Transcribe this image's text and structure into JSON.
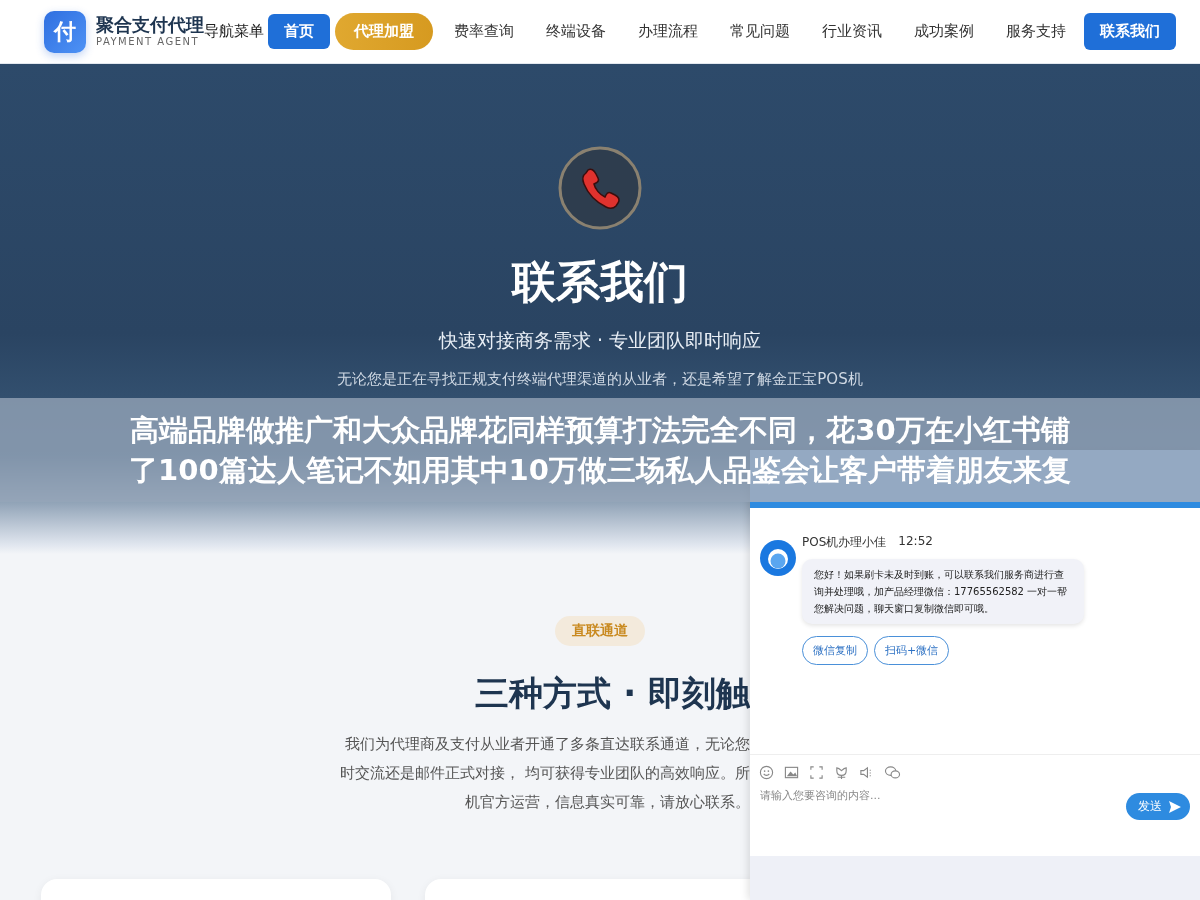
{
  "navbar": {
    "logo_mark": "付",
    "brand": "聚合支付代理",
    "brand_sub": "PAYMENT AGENT",
    "menu_label": "导航菜单",
    "items": [
      {
        "label": "首页",
        "kind": "primary"
      },
      {
        "label": "代理加盟",
        "kind": "accent"
      },
      {
        "label": "费率查询",
        "kind": "link"
      },
      {
        "label": "终端设备",
        "kind": "link"
      },
      {
        "label": "办理流程",
        "kind": "link"
      },
      {
        "label": "常见问题",
        "kind": "link"
      },
      {
        "label": "行业资讯",
        "kind": "link"
      },
      {
        "label": "成功案例",
        "kind": "link"
      },
      {
        "label": "服务支持",
        "kind": "link"
      },
      {
        "label": "联系我们",
        "kind": "primary"
      }
    ]
  },
  "hero": {
    "title": "联系我们",
    "subtitle": "快速对接商务需求 · 专业团队即时响应",
    "paragraph": "无论您是正在寻找正规支付终端代理渠道的从业者，还是希望了解金正宝POS机"
  },
  "overlay_banner": {
    "lines": [
      "高端品牌做推广和大众品牌花同样预算打法完全不同，花30万在小红书铺",
      "了100篇达人笔记不如用其中10万做三场私人品鉴会让客户带着朋友来复"
    ]
  },
  "channels_section": {
    "tag": "直联通道",
    "title": "三种方式 · 即刻触",
    "paragraph_lines": [
      "我们为代理商及支付从业者开通了多条直达联系通道，无论您",
      "时交流还是邮件正式对接， 均可获得专业团队的高效响应。所",
      "机官方运营，信息真实可靠，请放心联系。"
    ]
  },
  "chat": {
    "sender": "POS机办理小佳",
    "time": "12:52",
    "message": "您好！如果刷卡未及时到账，可以联系我们服务商进行查询并处理哦，加产品经理微信：17765562582 一对一帮您解决问题，聊天窗口复制微信即可哦。",
    "actions": [
      "微信复制",
      "扫码+微信"
    ],
    "input": {
      "placeholder": "请输入您要咨询的内容..."
    },
    "send": "发送"
  }
}
